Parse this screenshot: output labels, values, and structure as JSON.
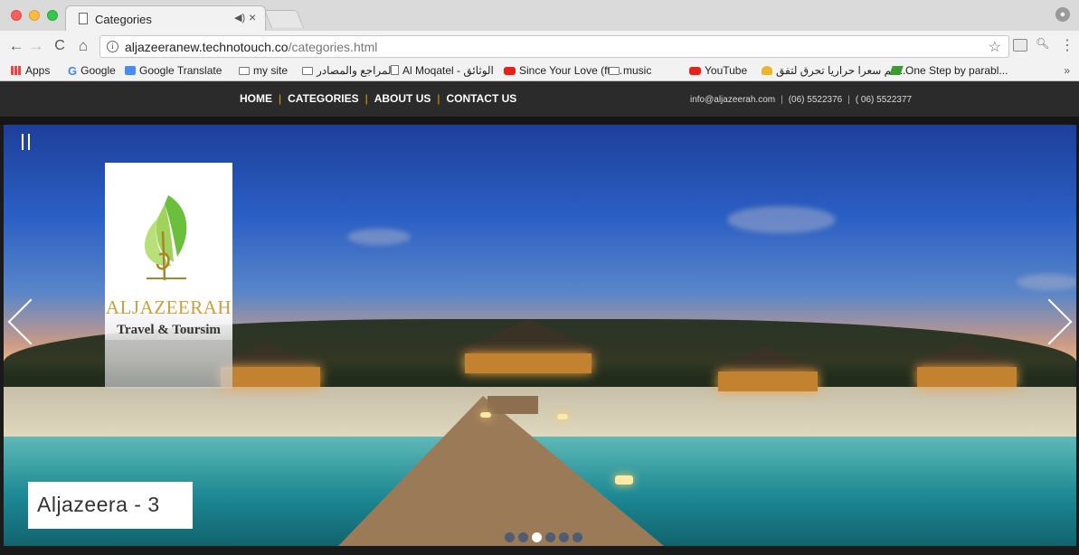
{
  "browser": {
    "tab_title": "Categories",
    "tab_audio": "◀)",
    "tab_close": "×",
    "url_host": "aljazeeranew.technotouch.co",
    "url_path": "/categories.html",
    "nav_icons": {
      "back": "←",
      "forward": "→",
      "reload": "C",
      "home": "⌂"
    },
    "bookmarks": [
      {
        "label": "Apps",
        "icon": "apps-grid-icon"
      },
      {
        "label": "Google",
        "icon": "google-icon"
      },
      {
        "label": "Google Translate",
        "icon": "google-translate-icon"
      },
      {
        "label": "my site",
        "icon": "folder-icon"
      },
      {
        "label": "المراجع والمصادر",
        "icon": "folder-icon"
      },
      {
        "label": "Al Moqatel - الوثائق",
        "icon": "page-icon"
      },
      {
        "label": "Since Your Love (ft....",
        "icon": "youtube-icon"
      },
      {
        "label": "music",
        "icon": "folder-icon"
      },
      {
        "label": "YouTube",
        "icon": "youtube-icon"
      },
      {
        "label": "كم سعرا حراريا تحرق لتفق...",
        "icon": "bookmark-favicon-icon"
      },
      {
        "label": "One Step by parabl...",
        "icon": "bookmark-favicon-icon"
      }
    ],
    "more": "»"
  },
  "site": {
    "nav": [
      "HOME",
      "CATEGORIES",
      "ABOUT US",
      "CONTACT US"
    ],
    "contact": {
      "email": "info@aljazeerah.com",
      "phone1": "(06) 5522376",
      "phone2": "( 06) 5522377"
    },
    "logo": {
      "name": "ALJAZEERAH",
      "tagline": "Travel & Toursim"
    },
    "slider": {
      "caption": "Aljazeera - 3",
      "total_slides": 6,
      "active_slide": 3
    }
  }
}
